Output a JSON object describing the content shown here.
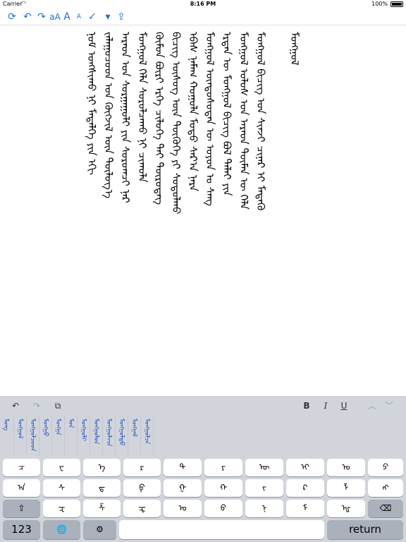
{
  "status_bar": {
    "carrier": "Carrier",
    "time": "8:16 PM",
    "battery": "100%"
  },
  "toolbar": {
    "items": [
      {
        "name": "refresh-icon",
        "glyph": "⟳"
      },
      {
        "name": "undo-icon",
        "glyph": "↶"
      },
      {
        "name": "redo-icon",
        "glyph": "↷"
      },
      {
        "name": "font-style-icon",
        "glyph": "aA"
      },
      {
        "name": "font-larger-icon",
        "glyph": "A"
      },
      {
        "name": "font-smaller-icon",
        "glyph": "A"
      },
      {
        "name": "checkmark-icon",
        "glyph": "✓"
      },
      {
        "name": "dropdown-icon",
        "glyph": "▾"
      },
      {
        "name": "share-icon",
        "glyph": "⇪"
      }
    ]
  },
  "document": {
    "columns": [
      "ᠮᠣᠩᠭᠣᠯ",
      "ᠮᠣᠩᠭᠣᠯ ᠪᠢᠴᠢᠭ ᠤᠨ ᠰᠢᠨᠵᠢ ᠴᠢᠨᠠᠷ ᠢ ᠮᠡᠳᠡᠬᠦ",
      "ᠮᠣᠩᠭᠣᠯ ᠤᠯᠤᠰ ᠤᠨ ᠠᠷᠠᠳ ᠲᠦᠮᠡᠨ ᠦ ᠬᠡᠯᠡ",
      "ᠡᠷᠲᠡᠨ ᠦ ᠮᠣᠩᠭᠣᠯ ᠪᠢᠴᠢᠭ ᠪᠣᠯ ᠲᠠᠯᠠᠢ ᠶᠢᠨ",
      "ᠮᠣᠩᠭᠣᠯ ᠦᠨᠳᠦᠰᠦᠲᠡᠨ ᠦ ᠣᠶᠤᠨ ᠤ ᠰᠠᠩ",
      "ᠡᠪᠡᠰ ᠨᠠᠮᠠᠭ ᠬᠣᠭᠣᠯᠠ ᠮᠣᠳᠣ ᠰᠠᠷ᠎ᠠ ᠨᠠᠷᠠ",
      "ᠪᠢᠴᠢᠭ ᠦᠰᠦᠭ ᠦᠨ ᠲᠦᠬᠦᠬᠡ ᠶᠢ ᠰᠤᠳᠤᠯᠬᠤ",
      "ᠬᠦᠮᠦᠨ ᠪᠦᠷᠢ ᠡᠷᠬᠡ ᠴᠢᠯᠥᠭᠡ ᠲᠡᠢ ᠲᠥᠷᠥᠳᠡᠭ",
      "ᠮᠣᠩᠭᠣᠯ ᠬᠡᠯᠡ ᠰᠤᠷᠤᠯᠴᠠᠬᠤ ᠨᠢ ᠴᠢᠬᠤᠯᠠ",
      "ᠠᠷᠠᠳ ᠤᠨ ᠰᠤᠷᠭᠠᠭᠤᠯᠢ ᠶᠢᠨ ᠰᠤᠷᠤᠭᠴᠢ ᠨᠠᠷ",
      "ᠵᠠᠯᠠᠭᠤᠴᠤᠳ ᠤᠨ ᠬᠥᠭᠵᠢᠯ ᠦᠨ ᠲᠥᠯᠥᠭ᠎ᠡ",
      "ᠨᠣᠮ ᠤᠩᠰᠢᠬᠤ ᠨᠢ ᠮᠡᠳᠡᠯᠭᠡ ᠶᠢᠨ ᠡᠬᠢ"
    ]
  },
  "keyboard": {
    "toolbar": {
      "undo": "↶",
      "redo": "↷",
      "copy": "⧉",
      "bold": "B",
      "italic": "I",
      "underline": "U",
      "up": "︿",
      "down": "﹀"
    },
    "candidates": [
      "ᠮᠣᠩ",
      "ᠮᠣᠩᠭᠣᠯ",
      "ᠮᠣᠩᠭᠣᠯᠴᠤᠳ",
      "ᠮᠣᠩᠭᠣ",
      "ᠮᠣᠩᠭᠠ",
      "ᠮᠣᠨ",
      "ᠮᠣᠩᠭᠣᠯᠢ",
      "ᠮᠣᠩᠭᠣᠯᠤᠨ",
      "ᠮᠣᠩᠭᠣᠯᠵᠢᠨ",
      "ᠮᠣᠩᠭᠣᠯᠳᠤ",
      "ᠮᠣᠩᠭᠠᠯ",
      "ᠮᠣᠩᠭᠣᠯᠴᠠ"
    ],
    "rows": [
      [
        "ᠴ",
        "ᠸ",
        "ᠡ",
        "ᠷ",
        "ᠲ",
        "ᠶ",
        "ᠦ",
        "ᠢ",
        "ᠣ",
        "ᠫ"
      ],
      [
        "ᠠ",
        "ᠰ",
        "ᠳ",
        "ᠹ",
        "ᠭ",
        "ᠬ",
        "ᠵ",
        "ᠺ",
        "ᠯ",
        "ᠩ"
      ],
      [
        "ᠽ",
        "ᠱ",
        "ᠼ",
        "ᠤ",
        "ᠪ",
        "ᠨ",
        "ᠮ",
        "ᠾ"
      ]
    ],
    "shift_label": "⇧",
    "delete_label": "⌫",
    "numbers_label": "123",
    "globe_label": "🌐",
    "settings_label": "⚙",
    "return_label": "return"
  }
}
